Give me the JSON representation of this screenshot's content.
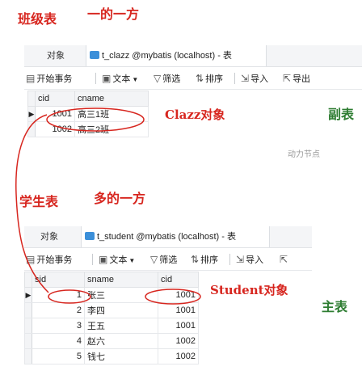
{
  "annotations": {
    "class_table": "班级表",
    "one_side": "一的一方",
    "clazz_object": "Clazz对象",
    "secondary_table": "副表",
    "student_table": "学生表",
    "many_side": "多的一方",
    "student_object": "Student对象",
    "main_table": "主表"
  },
  "watermark": "动力节点",
  "clazz_window": {
    "tab_objects": "对象",
    "tab_title": "t_clazz @mybatis (localhost) - 表",
    "toolbar": {
      "begin_tx": "开始事务",
      "text": "文本",
      "filter": "筛选",
      "sort": "排序",
      "import": "导入",
      "export": "导出"
    },
    "columns": [
      "cid",
      "cname"
    ],
    "rows": [
      {
        "cid": "1001",
        "cname": "高三1班"
      },
      {
        "cid": "1002",
        "cname": "高三2班"
      }
    ]
  },
  "student_window": {
    "tab_objects": "对象",
    "tab_title": "t_student @mybatis (localhost) - 表",
    "toolbar": {
      "begin_tx": "开始事务",
      "text": "文本",
      "filter": "筛选",
      "sort": "排序",
      "import": "导入"
    },
    "columns": [
      "sid",
      "sname",
      "cid"
    ],
    "rows": [
      {
        "sid": "1",
        "sname": "张三",
        "cid": "1001"
      },
      {
        "sid": "2",
        "sname": "李四",
        "cid": "1001"
      },
      {
        "sid": "3",
        "sname": "王五",
        "cid": "1001"
      },
      {
        "sid": "4",
        "sname": "赵六",
        "cid": "1002"
      },
      {
        "sid": "5",
        "sname": "钱七",
        "cid": "1002"
      }
    ]
  },
  "colors": {
    "annotation_red": "#d7261f",
    "annotation_green": "#2e7d32",
    "table_icon_blue": "#3b8fd9"
  }
}
